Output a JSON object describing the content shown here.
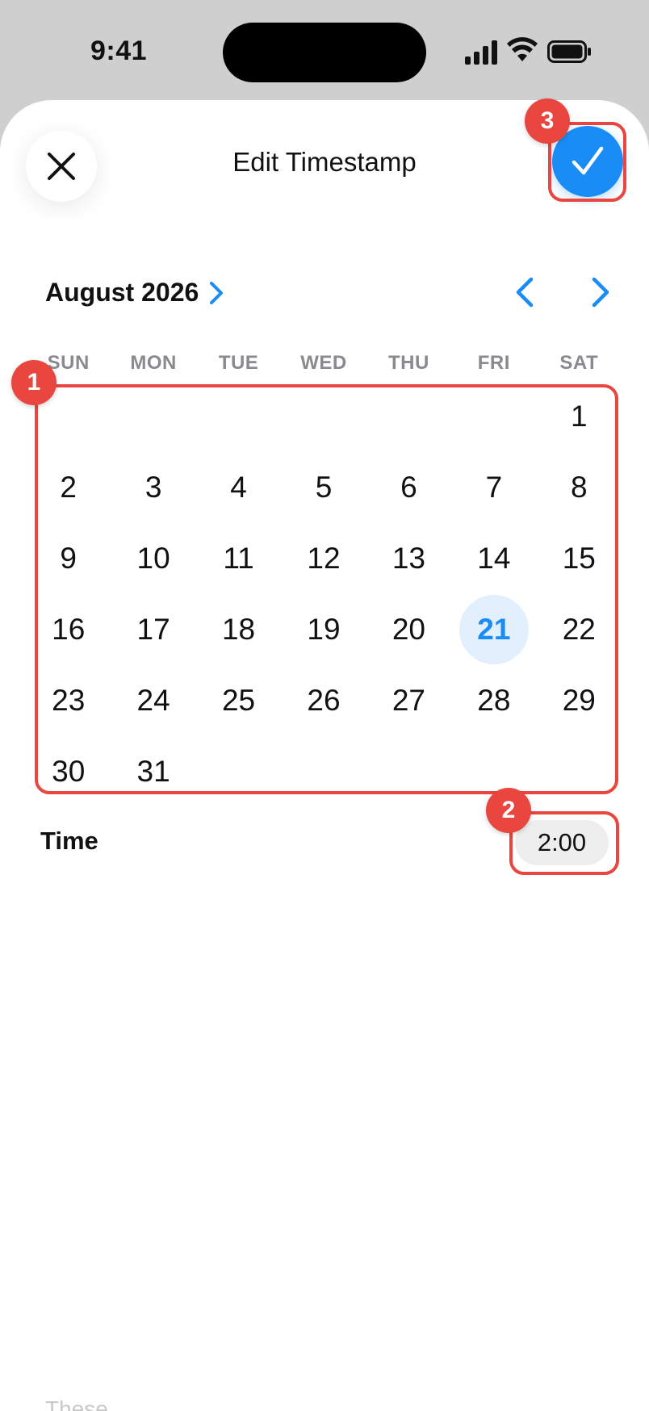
{
  "status_bar": {
    "time": "9:41"
  },
  "sheet": {
    "title": "Edit Timestamp",
    "close_icon": "close-icon",
    "confirm_icon": "checkmark-icon"
  },
  "calendar": {
    "month_label": "August 2026",
    "weekdays": [
      "SUN",
      "MON",
      "TUE",
      "WED",
      "THU",
      "FRI",
      "SAT"
    ],
    "days": {
      "d1": "1",
      "d2": "2",
      "d3": "3",
      "d4": "4",
      "d5": "5",
      "d6": "6",
      "d7": "7",
      "d8": "8",
      "d9": "9",
      "d10": "10",
      "d11": "11",
      "d12": "12",
      "d13": "13",
      "d14": "14",
      "d15": "15",
      "d16": "16",
      "d17": "17",
      "d18": "18",
      "d19": "19",
      "d20": "20",
      "d21": "21",
      "d22": "22",
      "d23": "23",
      "d24": "24",
      "d25": "25",
      "d26": "26",
      "d27": "27",
      "d28": "28",
      "d29": "29",
      "d30": "30",
      "d31": "31"
    },
    "selected_day": "21"
  },
  "time": {
    "label": "Time",
    "value": "2:00"
  },
  "bottom_hint": "These",
  "annotations": {
    "a1": "1",
    "a2": "2",
    "a3": "3"
  },
  "colors": {
    "accent": "#1a8cf5",
    "selected_bg": "#e2f0fd",
    "annotation": "#e8463f"
  }
}
